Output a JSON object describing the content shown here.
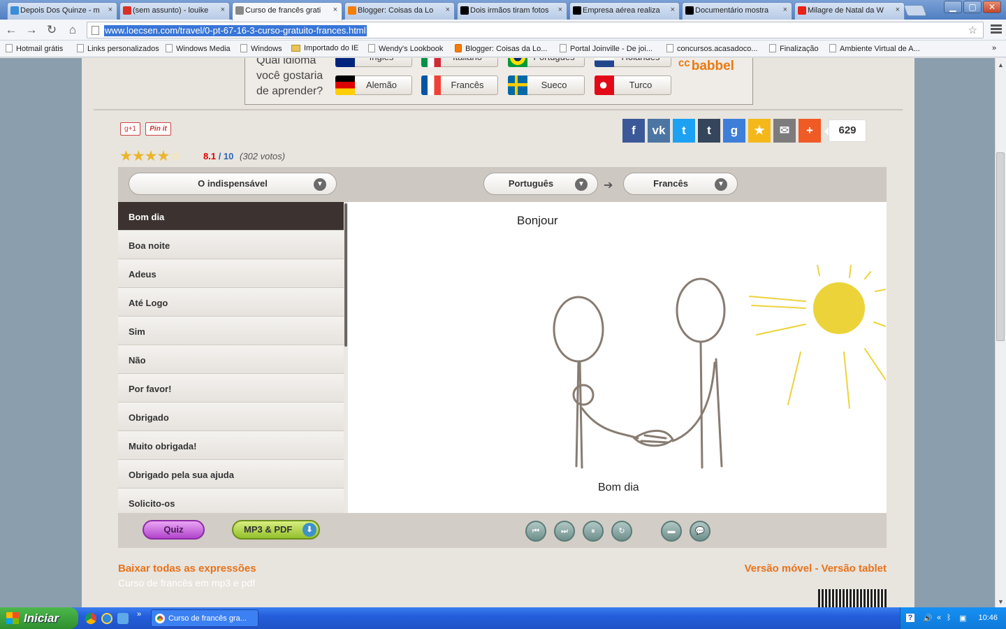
{
  "browser": {
    "tabs": [
      {
        "title": "Depois Dos Quinze - m",
        "favicon_color": "#3a8dd8",
        "active": false
      },
      {
        "title": "(sem assunto) - louike",
        "favicon_color": "#d93025",
        "active": false
      },
      {
        "title": "Curso de francês grati",
        "favicon_color": "#888888",
        "active": true
      },
      {
        "title": "Blogger: Coisas da Lo",
        "favicon_color": "#f57d00",
        "active": false
      },
      {
        "title": "Dois irmãos tiram fotos",
        "favicon_color": "#000000",
        "active": false
      },
      {
        "title": "Empresa aérea realiza",
        "favicon_color": "#000000",
        "active": false
      },
      {
        "title": "Documentário mostra",
        "favicon_color": "#000000",
        "active": false
      },
      {
        "title": "Milagre de Natal da W",
        "favicon_color": "#e62117",
        "active": false
      }
    ],
    "tab_close": "×",
    "window_buttons": {
      "minimize": "▁",
      "maximize": "▢",
      "close": "✕"
    },
    "url": "www.loecsen.com/travel/0-pt-67-16-3-curso-gratuito-frances.html",
    "bookmarks": [
      {
        "label": "Hotmail grátis",
        "icon": "page"
      },
      {
        "label": "Links personalizados",
        "icon": "page"
      },
      {
        "label": "Windows Media",
        "icon": "page"
      },
      {
        "label": "Windows",
        "icon": "page"
      },
      {
        "label": "Importado do IE",
        "icon": "folder"
      },
      {
        "label": "Wendy's Lookbook",
        "icon": "page"
      },
      {
        "label": "Blogger: Coisas da Lo...",
        "icon": "blogger"
      },
      {
        "label": "Portal Joinville - De joi...",
        "icon": "page"
      },
      {
        "label": "concursos.acasadoco...",
        "icon": "page"
      },
      {
        "label": "Finalização",
        "icon": "page"
      },
      {
        "label": "Ambiente Virtual de A...",
        "icon": "page"
      }
    ],
    "bookmarks_more": "»"
  },
  "language_picker": {
    "question": "Qual idioma você gostaria de aprender?",
    "buttons": [
      {
        "label": "Inglês",
        "flag": "uk"
      },
      {
        "label": "Italiano",
        "flag": "it"
      },
      {
        "label": "Português",
        "flag": "br"
      },
      {
        "label": "Holandês",
        "flag": "nl"
      },
      {
        "label": "Alemão",
        "flag": "de"
      },
      {
        "label": "Francês",
        "flag": "fr"
      },
      {
        "label": "Sueco",
        "flag": "se"
      },
      {
        "label": "Turco",
        "flag": "tr"
      }
    ],
    "brand": "babbel"
  },
  "social": {
    "gplus": "g+1",
    "pinit": "Pin it",
    "buttons": [
      {
        "label": "f",
        "color": "#3b5998",
        "icon": "facebook-icon"
      },
      {
        "label": "vk",
        "color": "#4c75a3",
        "icon": "vk-icon"
      },
      {
        "label": "t",
        "color": "#1da1f2",
        "icon": "twitter-icon"
      },
      {
        "label": "t",
        "color": "#35465c",
        "icon": "tumblr-icon"
      },
      {
        "label": "g",
        "color": "#3d7ed8",
        "icon": "google-icon"
      },
      {
        "label": "★",
        "color": "#f5b81b",
        "icon": "star-icon"
      },
      {
        "label": "✉",
        "color": "#7c7c7c",
        "icon": "email-icon"
      },
      {
        "label": "+",
        "color": "#f05a24",
        "icon": "plus-icon"
      }
    ],
    "share_count": "629"
  },
  "rating": {
    "stars": "★★★★",
    "empty_star": "★",
    "score": "8.1",
    "separator": " / ",
    "max": "10",
    "votes": "(302 votos)"
  },
  "course": {
    "category": "O indispensável",
    "from_language": "Português",
    "to_language": "Francês",
    "direction_arrow": "➔",
    "phrases": [
      "Bom dia",
      "Boa noite",
      "Adeus",
      "Até Logo",
      "Sim",
      "Não",
      "Por favor!",
      "Obrigado",
      "Muito obrigada!",
      "Obrigado pela sua ajuda",
      "Solicito-os"
    ],
    "selected_phrase_index": 0,
    "translation": "Bonjour",
    "native": "Bom dia",
    "quiz_label": "Quiz",
    "mp3_label": "MP3 & PDF",
    "player_buttons": [
      {
        "glyph": "⏮",
        "icon": "previous-icon"
      },
      {
        "glyph": "⏭",
        "icon": "next-icon"
      },
      {
        "glyph": "⏸",
        "icon": "pause-icon"
      },
      {
        "glyph": "↻",
        "icon": "repeat-icon"
      },
      {
        "glyph": "▬",
        "icon": "subtitle-icon"
      },
      {
        "glyph": "💬",
        "icon": "dialog-icon"
      }
    ]
  },
  "footer": {
    "download_all": "Baixar todas as expressões",
    "download_sub": "Curso de francês em mp3 e pdf",
    "mobile": "Versão móvel - Versão tablet"
  },
  "taskbar": {
    "start": "Iniciar",
    "task_title": "Curso de francês gra...",
    "clock": "10:46",
    "quicklaunch_more": "»"
  }
}
